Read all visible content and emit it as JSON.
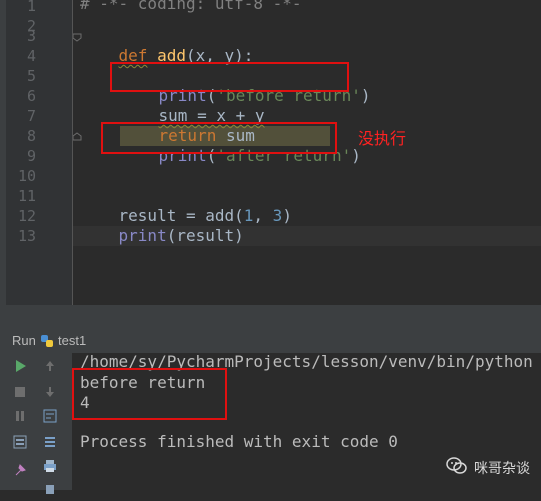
{
  "editor": {
    "line_numbers": [
      "1",
      "2",
      "3",
      "4",
      "5",
      "6",
      "7",
      "8",
      "9",
      "10",
      "11",
      "12",
      "13"
    ],
    "line1": "# -*- coding: utf-8 -*-",
    "line3": {
      "kw": "def",
      "fn": "add",
      "open": "(",
      "p1": "x",
      "comma": ", ",
      "p2": "y",
      "close": "):"
    },
    "line5": {
      "builtin": "print",
      "open": "(",
      "str": "'before return'",
      "close": ")"
    },
    "line6": "sum = x + y",
    "line7": {
      "kw": "return",
      "rest": " sum"
    },
    "line8": {
      "builtin": "print",
      "open": "(",
      "str": "'after return'",
      "close": ")"
    },
    "line11": {
      "prefix": "result = add(",
      "n1": "1",
      "sep": ", ",
      "n2": "3",
      "suffix": ")"
    },
    "line12": {
      "builtin": "print",
      "rest": "(result)"
    },
    "annotation": "没执行"
  },
  "run_panel": {
    "label": "Run",
    "config": "test1",
    "console_lines": [
      "/home/sy/PycharmProjects/lesson/venv/bin/python",
      "before return",
      "4",
      "",
      "Process finished with exit code 0"
    ]
  },
  "watermark": {
    "text": "咪哥杂谈"
  },
  "colors": {
    "keyword": "#cc7832",
    "function": "#ffc66d",
    "string": "#6a8759",
    "number": "#6897bb",
    "builtin": "#8888c6",
    "annotation_box": "#e01010",
    "run_green": "#59a869"
  },
  "icons": [
    "run-icon",
    "stop-icon",
    "pause-icon",
    "up-arrow-icon",
    "down-arrow-icon",
    "soft-wrap-icon",
    "print-icon",
    "delete-icon",
    "python-file-icon",
    "wechat-icon"
  ]
}
